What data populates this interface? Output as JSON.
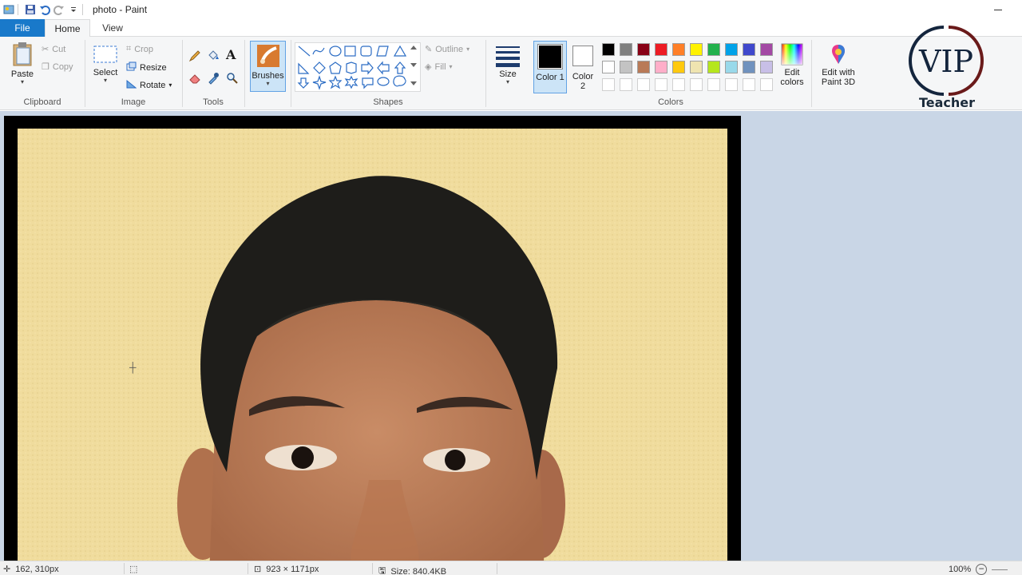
{
  "window": {
    "title": "photo - Paint"
  },
  "tabs": {
    "file": "File",
    "home": "Home",
    "view": "View"
  },
  "clipboard": {
    "paste": "Paste",
    "cut": "Cut",
    "copy": "Copy",
    "label": "Clipboard"
  },
  "image": {
    "select": "Select",
    "crop": "Crop",
    "resize": "Resize",
    "rotate": "Rotate",
    "label": "Image"
  },
  "tools": {
    "label": "Tools"
  },
  "brushes": {
    "label": "Brushes"
  },
  "shapes": {
    "outline": "Outline",
    "fill": "Fill",
    "label": "Shapes"
  },
  "size": {
    "label": "Size"
  },
  "colors": {
    "color1": "Color 1",
    "color2": "Color 2",
    "edit_colors": "Edit colors",
    "edit_paint3d": "Edit with Paint 3D",
    "label": "Colors",
    "color1_value": "#000000",
    "color2_value": "#ffffff",
    "palette_row1": [
      "#000000",
      "#7f7f7f",
      "#880015",
      "#ed1c24",
      "#ff7f27",
      "#fff200",
      "#22b14c",
      "#00a2e8",
      "#3f48cc",
      "#a349a4"
    ],
    "palette_row2": [
      "#ffffff",
      "#c3c3c3",
      "#b97a57",
      "#ffaec9",
      "#ffc90e",
      "#efe4b0",
      "#b5e61d",
      "#99d9ea",
      "#7092be",
      "#c8bfe7"
    ]
  },
  "status": {
    "cursor": "162, 310px",
    "dimensions": "923 × 1171px",
    "size": "Size: 840.4KB",
    "zoom": "100%"
  },
  "logo": {
    "text": "VIP",
    "subtitle": "Teacher"
  }
}
